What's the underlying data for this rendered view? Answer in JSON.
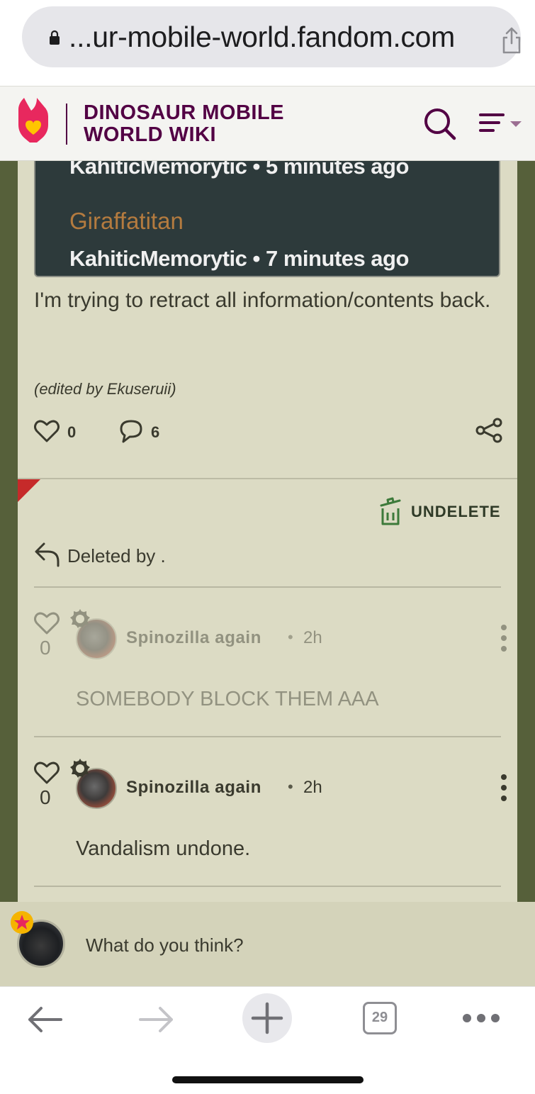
{
  "browser": {
    "url": "...ur-mobile-world.fandom.com",
    "tab_count": "29"
  },
  "header": {
    "wiki_title_line1": "DINOSAUR MOBILE",
    "wiki_title_line2": "WORLD WIKI",
    "brand_color": "#520044"
  },
  "embed": {
    "meta_top": "KahiticMemorytic • 5 minutes ago",
    "item_title": "Giraffatitan",
    "meta_bottom": "KahiticMemorytic • 7 minutes ago"
  },
  "post": {
    "text": "I'm trying to retract all information/contents back.",
    "edited_by": "(edited by Ekuseruii)",
    "likes": "0",
    "comments": "6"
  },
  "moderation": {
    "undelete_label": "UNDELETE",
    "deleted_by": "Deleted by ."
  },
  "replies": [
    {
      "likes": "0",
      "author": "Spinozilla again",
      "time": "2h",
      "text": "SOMEBODY BLOCK THEM AAA",
      "deleted": true
    },
    {
      "likes": "0",
      "author": "Spinozilla again",
      "time": "2h",
      "text": "Vandalism undone.",
      "deleted": false
    }
  ],
  "composer": {
    "placeholder": "What do you think?"
  },
  "colors": {
    "page_bg": "#56603a",
    "card_bg": "#dcdbc4",
    "deleted_flag": "#c62a2a",
    "undelete_icon": "#3d7a3a"
  }
}
